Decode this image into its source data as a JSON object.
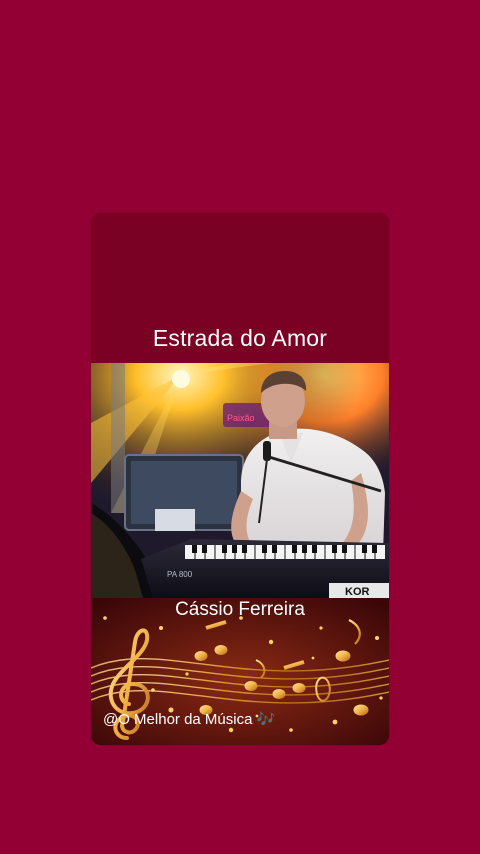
{
  "post": {
    "song_title": "Estrada do Amor",
    "artist_name": "Cássio Ferreira",
    "channel_tag": "@O Melhor da Música",
    "channel_emoji": "🎶"
  },
  "photo": {
    "keyboard_model": "PA 800",
    "brand_partial": "KOR"
  },
  "colors": {
    "background": "#930033",
    "header": "#7a0024",
    "notes_panel": "#5a0d0b",
    "notes_gold": "#f2b447"
  }
}
